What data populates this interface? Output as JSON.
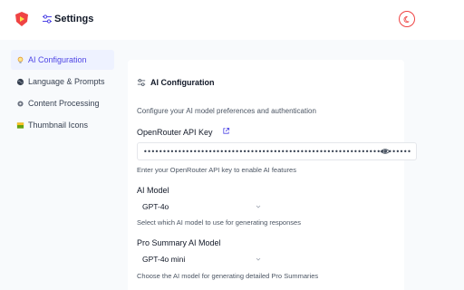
{
  "header": {
    "title": "Settings",
    "logo_icon": "shield-play-logo",
    "theme_icon": "moon-icon",
    "accent": "#ef4444"
  },
  "sidebar": {
    "items": [
      {
        "label": "AI Configuration",
        "icon": "lightbulb-icon",
        "active": true
      },
      {
        "label": "Language & Prompts",
        "icon": "globe-icon",
        "active": false
      },
      {
        "label": "Content Processing",
        "icon": "gear-icon",
        "active": false
      },
      {
        "label": "Thumbnail Icons",
        "icon": "image-icon",
        "active": false
      }
    ]
  },
  "card": {
    "title": "AI Configuration",
    "description": "Configure your AI model preferences and authentication",
    "api_key": {
      "label": "OpenRouter API Key",
      "value": "••••••••••••••••••••••••••••••••••••••••••••••••••••••••••••••••••••••",
      "help": "Enter your OpenRouter API key to enable AI features"
    },
    "ai_model": {
      "label": "AI Model",
      "value": "GPT-4o",
      "help": "Select which AI model to use for generating responses"
    },
    "pro_model": {
      "label": "Pro Summary AI Model",
      "value": "GPT-4o mini",
      "help": "Choose the AI model for generating detailed Pro Summaries"
    }
  },
  "colors": {
    "active_bg": "#eef2ff",
    "active_text": "#4f46e5"
  }
}
